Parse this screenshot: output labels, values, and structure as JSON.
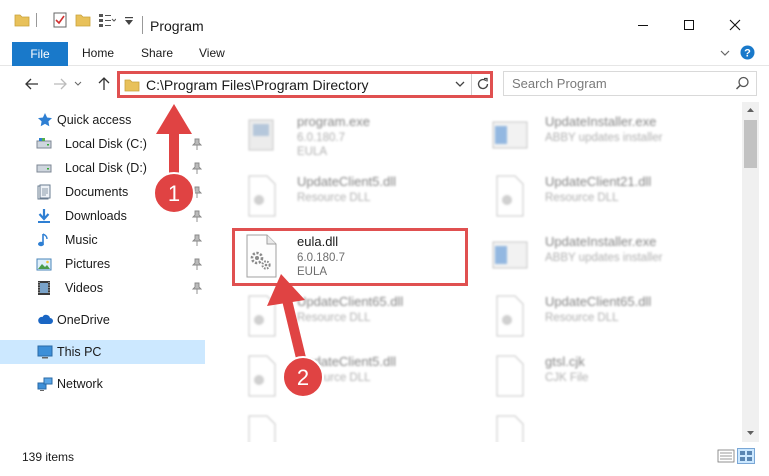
{
  "window": {
    "title": "Program"
  },
  "ribbon": {
    "tabs": [
      "File",
      "Home",
      "Share",
      "View"
    ]
  },
  "address": {
    "path": "C:\\Program Files\\Program Directory"
  },
  "search": {
    "placeholder": "Search Program"
  },
  "nav": {
    "quick_access": "Quick access",
    "items": [
      {
        "label": "Local Disk (C:)",
        "icon": "drive-icon",
        "pinned": true
      },
      {
        "label": "Local Disk (D:)",
        "icon": "drive-icon",
        "pinned": true
      },
      {
        "label": "Documents",
        "icon": "documents-icon",
        "pinned": true
      },
      {
        "label": "Downloads",
        "icon": "downloads-icon",
        "pinned": true
      },
      {
        "label": "Music",
        "icon": "music-icon",
        "pinned": true
      },
      {
        "label": "Pictures",
        "icon": "pictures-icon",
        "pinned": true
      },
      {
        "label": "Videos",
        "icon": "videos-icon",
        "pinned": true
      }
    ],
    "onedrive": "OneDrive",
    "this_pc": "This PC",
    "network": "Network"
  },
  "files": [
    {
      "name": "program.exe",
      "line2": "6.0.180.7",
      "line3": "EULA"
    },
    {
      "name": "UpdateInstaller.exe",
      "line2": "ABBY updates installer",
      "line3": ""
    },
    {
      "name": "UpdateClient5.dll",
      "line2": "Resource DLL",
      "line3": ""
    },
    {
      "name": "UpdateClient21.dll",
      "line2": "Resource DLL",
      "line3": ""
    },
    {
      "name": "eula.dll",
      "line2": "6.0.180.7",
      "line3": "EULA"
    },
    {
      "name": "UpdateInstaller.exe",
      "line2": "ABBY updates installer",
      "line3": ""
    },
    {
      "name": "UpdateClient65.dll",
      "line2": "Resource DLL",
      "line3": ""
    },
    {
      "name": "UpdateClient65.dll",
      "line2": "Resource DLL",
      "line3": ""
    },
    {
      "name": "UpdateClient5.dll",
      "line2": "Resource DLL",
      "line3": ""
    },
    {
      "name": "gtsl.cjk",
      "line2": "CJK File",
      "line3": ""
    }
  ],
  "callouts": [
    "1",
    "2"
  ],
  "status": {
    "count": "139 items"
  },
  "colors": {
    "accent": "#1979ca",
    "highlight": "#e05050",
    "selection": "#cce8ff"
  }
}
